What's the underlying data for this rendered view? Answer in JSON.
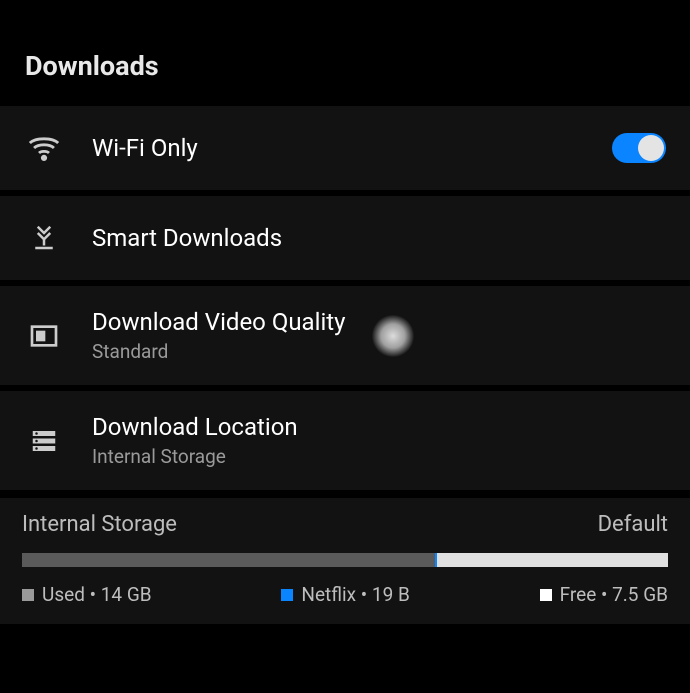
{
  "header": {
    "title": "Downloads"
  },
  "rows": {
    "wifi": {
      "label": "Wi-Fi Only"
    },
    "smart": {
      "label": "Smart Downloads"
    },
    "quality": {
      "label": "Download Video Quality",
      "sub": "Standard"
    },
    "location": {
      "label": "Download Location",
      "sub": "Internal Storage"
    }
  },
  "storage": {
    "title": "Internal Storage",
    "default_label": "Default",
    "bar": {
      "used_pct": 64,
      "netflix_pct": 0.3,
      "free_pct": 35.7
    },
    "legend": {
      "used": "Used • 14 GB",
      "netflix": "Netflix • 19 B",
      "free": "Free • 7.5 GB"
    }
  },
  "colors": {
    "accent": "#0a84ff"
  }
}
